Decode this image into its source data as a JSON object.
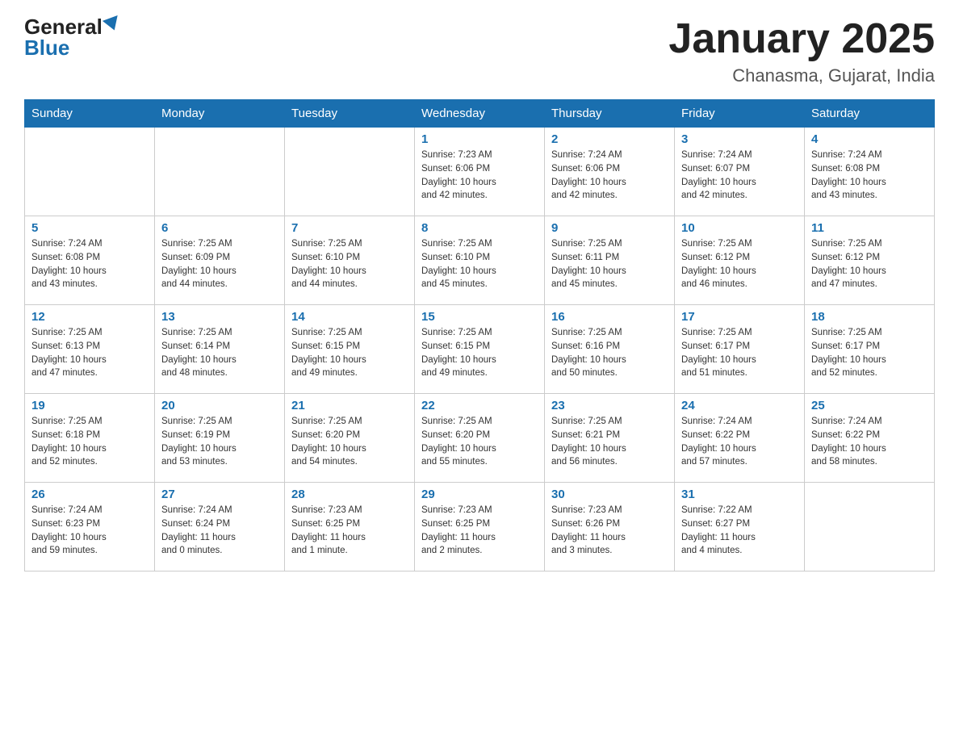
{
  "logo": {
    "general": "General",
    "blue": "Blue"
  },
  "title": "January 2025",
  "subtitle": "Chanasma, Gujarat, India",
  "headers": [
    "Sunday",
    "Monday",
    "Tuesday",
    "Wednesday",
    "Thursday",
    "Friday",
    "Saturday"
  ],
  "rows": [
    [
      {
        "day": "",
        "info": ""
      },
      {
        "day": "",
        "info": ""
      },
      {
        "day": "",
        "info": ""
      },
      {
        "day": "1",
        "info": "Sunrise: 7:23 AM\nSunset: 6:06 PM\nDaylight: 10 hours\nand 42 minutes."
      },
      {
        "day": "2",
        "info": "Sunrise: 7:24 AM\nSunset: 6:06 PM\nDaylight: 10 hours\nand 42 minutes."
      },
      {
        "day": "3",
        "info": "Sunrise: 7:24 AM\nSunset: 6:07 PM\nDaylight: 10 hours\nand 42 minutes."
      },
      {
        "day": "4",
        "info": "Sunrise: 7:24 AM\nSunset: 6:08 PM\nDaylight: 10 hours\nand 43 minutes."
      }
    ],
    [
      {
        "day": "5",
        "info": "Sunrise: 7:24 AM\nSunset: 6:08 PM\nDaylight: 10 hours\nand 43 minutes."
      },
      {
        "day": "6",
        "info": "Sunrise: 7:25 AM\nSunset: 6:09 PM\nDaylight: 10 hours\nand 44 minutes."
      },
      {
        "day": "7",
        "info": "Sunrise: 7:25 AM\nSunset: 6:10 PM\nDaylight: 10 hours\nand 44 minutes."
      },
      {
        "day": "8",
        "info": "Sunrise: 7:25 AM\nSunset: 6:10 PM\nDaylight: 10 hours\nand 45 minutes."
      },
      {
        "day": "9",
        "info": "Sunrise: 7:25 AM\nSunset: 6:11 PM\nDaylight: 10 hours\nand 45 minutes."
      },
      {
        "day": "10",
        "info": "Sunrise: 7:25 AM\nSunset: 6:12 PM\nDaylight: 10 hours\nand 46 minutes."
      },
      {
        "day": "11",
        "info": "Sunrise: 7:25 AM\nSunset: 6:12 PM\nDaylight: 10 hours\nand 47 minutes."
      }
    ],
    [
      {
        "day": "12",
        "info": "Sunrise: 7:25 AM\nSunset: 6:13 PM\nDaylight: 10 hours\nand 47 minutes."
      },
      {
        "day": "13",
        "info": "Sunrise: 7:25 AM\nSunset: 6:14 PM\nDaylight: 10 hours\nand 48 minutes."
      },
      {
        "day": "14",
        "info": "Sunrise: 7:25 AM\nSunset: 6:15 PM\nDaylight: 10 hours\nand 49 minutes."
      },
      {
        "day": "15",
        "info": "Sunrise: 7:25 AM\nSunset: 6:15 PM\nDaylight: 10 hours\nand 49 minutes."
      },
      {
        "day": "16",
        "info": "Sunrise: 7:25 AM\nSunset: 6:16 PM\nDaylight: 10 hours\nand 50 minutes."
      },
      {
        "day": "17",
        "info": "Sunrise: 7:25 AM\nSunset: 6:17 PM\nDaylight: 10 hours\nand 51 minutes."
      },
      {
        "day": "18",
        "info": "Sunrise: 7:25 AM\nSunset: 6:17 PM\nDaylight: 10 hours\nand 52 minutes."
      }
    ],
    [
      {
        "day": "19",
        "info": "Sunrise: 7:25 AM\nSunset: 6:18 PM\nDaylight: 10 hours\nand 52 minutes."
      },
      {
        "day": "20",
        "info": "Sunrise: 7:25 AM\nSunset: 6:19 PM\nDaylight: 10 hours\nand 53 minutes."
      },
      {
        "day": "21",
        "info": "Sunrise: 7:25 AM\nSunset: 6:20 PM\nDaylight: 10 hours\nand 54 minutes."
      },
      {
        "day": "22",
        "info": "Sunrise: 7:25 AM\nSunset: 6:20 PM\nDaylight: 10 hours\nand 55 minutes."
      },
      {
        "day": "23",
        "info": "Sunrise: 7:25 AM\nSunset: 6:21 PM\nDaylight: 10 hours\nand 56 minutes."
      },
      {
        "day": "24",
        "info": "Sunrise: 7:24 AM\nSunset: 6:22 PM\nDaylight: 10 hours\nand 57 minutes."
      },
      {
        "day": "25",
        "info": "Sunrise: 7:24 AM\nSunset: 6:22 PM\nDaylight: 10 hours\nand 58 minutes."
      }
    ],
    [
      {
        "day": "26",
        "info": "Sunrise: 7:24 AM\nSunset: 6:23 PM\nDaylight: 10 hours\nand 59 minutes."
      },
      {
        "day": "27",
        "info": "Sunrise: 7:24 AM\nSunset: 6:24 PM\nDaylight: 11 hours\nand 0 minutes."
      },
      {
        "day": "28",
        "info": "Sunrise: 7:23 AM\nSunset: 6:25 PM\nDaylight: 11 hours\nand 1 minute."
      },
      {
        "day": "29",
        "info": "Sunrise: 7:23 AM\nSunset: 6:25 PM\nDaylight: 11 hours\nand 2 minutes."
      },
      {
        "day": "30",
        "info": "Sunrise: 7:23 AM\nSunset: 6:26 PM\nDaylight: 11 hours\nand 3 minutes."
      },
      {
        "day": "31",
        "info": "Sunrise: 7:22 AM\nSunset: 6:27 PM\nDaylight: 11 hours\nand 4 minutes."
      },
      {
        "day": "",
        "info": ""
      }
    ]
  ]
}
